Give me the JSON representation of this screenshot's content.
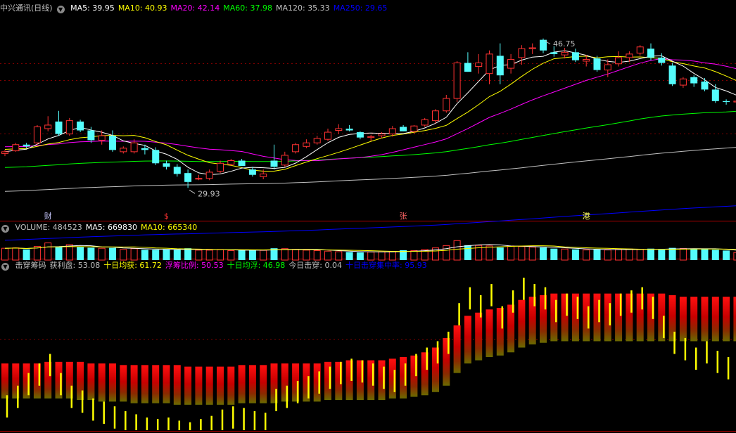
{
  "colors": {
    "bg": "#000000",
    "up": "#ff3232",
    "down": "#54fcfc",
    "ma5": "#ffffff",
    "ma10": "#ffff00",
    "ma20": "#ff00ff",
    "ma60": "#00ff00",
    "ma120": "#c0c0c0",
    "ma250": "#0000ff",
    "divider": "#b00000",
    "grid": "#7f0000"
  },
  "price_panel": {
    "title": "中兴通讯(日线)",
    "collapse_icon": "chevron-down-icon",
    "indicators": [
      {
        "label": "MA5: 39.95",
        "color": "#ffffff"
      },
      {
        "label": "MA10: 40.93",
        "color": "#ffff00"
      },
      {
        "label": "MA20: 42.14",
        "color": "#ff00ff"
      },
      {
        "label": "MA60: 37.98",
        "color": "#00ff00"
      },
      {
        "label": "MA120: 35.33",
        "color": "#c0c0c0"
      },
      {
        "label": "MA250: 29.65",
        "color": "#0000ff"
      }
    ],
    "high_label": "46.75",
    "low_label": "29.93",
    "events": [
      {
        "label": "财",
        "color": "#c8c8ff",
        "index": 4
      },
      {
        "label": "$",
        "color": "#ff3232",
        "index": 15
      },
      {
        "label": "张",
        "color": "#ff6464",
        "index": 37
      },
      {
        "label": "港",
        "color": "#ffff64",
        "index": 54
      }
    ]
  },
  "volume_panel": {
    "collapse_icon": "chevron-down-icon",
    "indicators": [
      {
        "label": "VOLUME: 484523",
        "color": "#c0c0c0"
      },
      {
        "label": "MA5: 669830",
        "color": "#ffffff"
      },
      {
        "label": "MA10: 665340",
        "color": "#ffff00"
      }
    ]
  },
  "chip_panel": {
    "collapse_icon": "chevron-down-icon",
    "indicators": [
      {
        "label": "击穿筹码",
        "color": "#c0c0c0"
      },
      {
        "label": "获利盘: 53.08",
        "color": "#c0c0c0"
      },
      {
        "label": "十日均获: 61.72",
        "color": "#ffff00"
      },
      {
        "label": "浮筹比例: 50.53",
        "color": "#ff00ff"
      },
      {
        "label": "十日均浮: 46.98",
        "color": "#00ff00"
      },
      {
        "label": "今日击穿: 0.04",
        "color": "#c0c0c0"
      },
      {
        "label": "十日击穿集中率: 95.93",
        "color": "#0000ff"
      }
    ]
  },
  "chart_data": {
    "type": "candlestick",
    "price_ylim": [
      27.5,
      49.5
    ],
    "candles": [
      [
        33.8,
        34.2,
        33.5,
        34.0
      ],
      [
        34.1,
        35.0,
        34.0,
        34.8
      ],
      [
        34.8,
        35.0,
        34.4,
        34.6
      ],
      [
        35.0,
        37.0,
        34.8,
        36.8
      ],
      [
        36.6,
        38.0,
        36.3,
        37.0
      ],
      [
        37.4,
        38.6,
        35.8,
        36.0
      ],
      [
        36.0,
        37.8,
        35.8,
        37.5
      ],
      [
        37.4,
        37.6,
        36.2,
        36.4
      ],
      [
        36.4,
        36.8,
        35.0,
        35.3
      ],
      [
        35.3,
        36.4,
        34.8,
        35.8
      ],
      [
        35.8,
        36.4,
        34.0,
        34.2
      ],
      [
        34.0,
        34.6,
        33.8,
        34.4
      ],
      [
        34.0,
        35.4,
        33.8,
        35.0
      ],
      [
        34.4,
        34.8,
        33.7,
        34.2
      ],
      [
        34.2,
        34.5,
        32.5,
        32.7
      ],
      [
        32.7,
        33.0,
        32.0,
        32.3
      ],
      [
        32.3,
        32.6,
        31.2,
        31.5
      ],
      [
        31.6,
        32.0,
        29.93,
        30.6
      ],
      [
        31.0,
        31.4,
        30.8,
        31.0
      ],
      [
        31.0,
        32.0,
        30.8,
        31.7
      ],
      [
        31.8,
        33.0,
        31.6,
        32.7
      ],
      [
        32.6,
        33.2,
        32.4,
        33.0
      ],
      [
        33.0,
        33.2,
        32.4,
        32.4
      ],
      [
        32.0,
        32.3,
        31.2,
        31.4
      ],
      [
        31.2,
        32.0,
        30.9,
        31.5
      ],
      [
        33.0,
        34.8,
        32.0,
        32.3
      ],
      [
        32.5,
        34.0,
        32.3,
        33.6
      ],
      [
        34.0,
        35.0,
        33.8,
        34.8
      ],
      [
        34.6,
        35.4,
        34.4,
        35.0
      ],
      [
        35.0,
        35.8,
        34.8,
        35.5
      ],
      [
        35.4,
        36.6,
        35.2,
        36.2
      ],
      [
        36.4,
        37.1,
        36.0,
        36.6
      ],
      [
        36.6,
        37.0,
        36.3,
        36.4
      ],
      [
        36.2,
        36.3,
        35.4,
        35.6
      ],
      [
        35.6,
        35.9,
        35.2,
        35.7
      ],
      [
        35.8,
        36.2,
        35.5,
        36.0
      ],
      [
        36.0,
        36.9,
        35.7,
        36.6
      ],
      [
        36.8,
        37.0,
        36.3,
        36.3
      ],
      [
        36.3,
        37.0,
        36.0,
        36.9
      ],
      [
        37.0,
        37.8,
        36.8,
        37.6
      ],
      [
        37.5,
        38.8,
        37.2,
        38.6
      ],
      [
        38.6,
        40.4,
        38.4,
        40.0
      ],
      [
        40.0,
        44.2,
        39.6,
        44.0
      ],
      [
        44.0,
        45.2,
        43.0,
        43.0
      ],
      [
        43.6,
        45.0,
        42.8,
        44.0
      ],
      [
        42.8,
        45.4,
        41.6,
        45.0
      ],
      [
        44.8,
        46.2,
        41.6,
        42.6
      ],
      [
        43.4,
        45.0,
        42.8,
        44.4
      ],
      [
        44.6,
        46.0,
        43.8,
        45.6
      ],
      [
        45.6,
        46.2,
        45.0,
        45.7
      ],
      [
        46.6,
        46.75,
        45.1,
        45.4
      ],
      [
        45.2,
        45.9,
        44.7,
        45.0
      ],
      [
        44.9,
        45.7,
        44.5,
        45.2
      ],
      [
        45.2,
        45.6,
        44.1,
        44.3
      ],
      [
        44.2,
        44.9,
        43.6,
        44.4
      ],
      [
        44.5,
        44.8,
        43.0,
        43.2
      ],
      [
        43.2,
        44.4,
        42.4,
        43.8
      ],
      [
        43.9,
        45.3,
        43.6,
        44.6
      ],
      [
        44.6,
        45.3,
        44.1,
        45.0
      ],
      [
        45.1,
        46.0,
        44.8,
        45.8
      ],
      [
        45.6,
        46.2,
        44.3,
        44.6
      ],
      [
        44.6,
        45.1,
        43.7,
        44.0
      ],
      [
        43.7,
        44.0,
        41.4,
        41.6
      ],
      [
        41.5,
        42.4,
        41.2,
        42.2
      ],
      [
        42.4,
        42.6,
        41.3,
        41.7
      ],
      [
        41.9,
        42.3,
        40.8,
        41.0
      ],
      [
        41.0,
        41.6,
        39.5,
        39.7
      ],
      [
        39.7,
        39.9,
        39.3,
        39.6
      ],
      [
        39.6,
        40.0,
        39.4,
        39.7
      ]
    ],
    "volumes": [
      620,
      640,
      560,
      720,
      900,
      700,
      810,
      690,
      650,
      620,
      640,
      560,
      600,
      540,
      540,
      560,
      540,
      620,
      520,
      520,
      540,
      500,
      520,
      520,
      510,
      620,
      600,
      560,
      520,
      500,
      470,
      440,
      420,
      400,
      420,
      430,
      460,
      520,
      500,
      560,
      640,
      760,
      1020,
      780,
      770,
      740,
      660,
      740,
      710,
      680,
      660,
      600,
      580,
      560,
      530,
      560,
      530,
      560,
      580,
      560,
      600,
      540,
      640,
      610,
      590,
      580,
      540,
      500,
      400
    ],
    "volume_ylim": [
      0,
      1400
    ],
    "chip_ylim": [
      0,
      100
    ],
    "profit": [
      22,
      28,
      36,
      42,
      48,
      36,
      28,
      25,
      20,
      18,
      15,
      12,
      10,
      8,
      7,
      8,
      6,
      5,
      7,
      9,
      13,
      15,
      14,
      12,
      11,
      26,
      28,
      31,
      34,
      37,
      40,
      43,
      45,
      44,
      42,
      40,
      38,
      42,
      48,
      52,
      56,
      62,
      80,
      90,
      85,
      92,
      78,
      88,
      96,
      92,
      90,
      82,
      86,
      84,
      78,
      82,
      80,
      86,
      88,
      90,
      84,
      72,
      62,
      58,
      52,
      56,
      50,
      46,
      48
    ],
    "profit10": [
      42,
      42,
      42,
      42,
      43,
      43,
      43,
      43,
      42,
      42,
      42,
      41,
      41,
      41,
      41,
      41,
      41,
      40,
      40,
      40,
      40,
      40,
      41,
      41,
      41,
      42,
      42,
      42,
      42,
      42,
      43,
      43,
      44,
      44,
      44,
      44,
      45,
      46,
      47,
      49,
      52,
      58,
      66,
      72,
      74,
      76,
      77,
      79,
      82,
      84,
      85,
      86,
      86,
      86,
      86,
      86,
      86,
      86,
      86,
      86,
      86,
      86,
      85,
      84,
      84,
      84,
      84,
      84,
      84
    ],
    "float": [
      34,
      34,
      34,
      34,
      34,
      34,
      34,
      33,
      33,
      32,
      32,
      32,
      31,
      31,
      31,
      31,
      30,
      30,
      30,
      30,
      30,
      30,
      31,
      31,
      31,
      31,
      32,
      32,
      32,
      32,
      33,
      33,
      33,
      33,
      33,
      33,
      34,
      34,
      35,
      36,
      38,
      42,
      50,
      56,
      58,
      60,
      61,
      63,
      66,
      68,
      69,
      70,
      70,
      70,
      70,
      70,
      70,
      70,
      70,
      70,
      70,
      70,
      70,
      70,
      70,
      70,
      70,
      70,
      70
    ],
    "today_break": 0.04,
    "break_concentration": 95.93
  }
}
